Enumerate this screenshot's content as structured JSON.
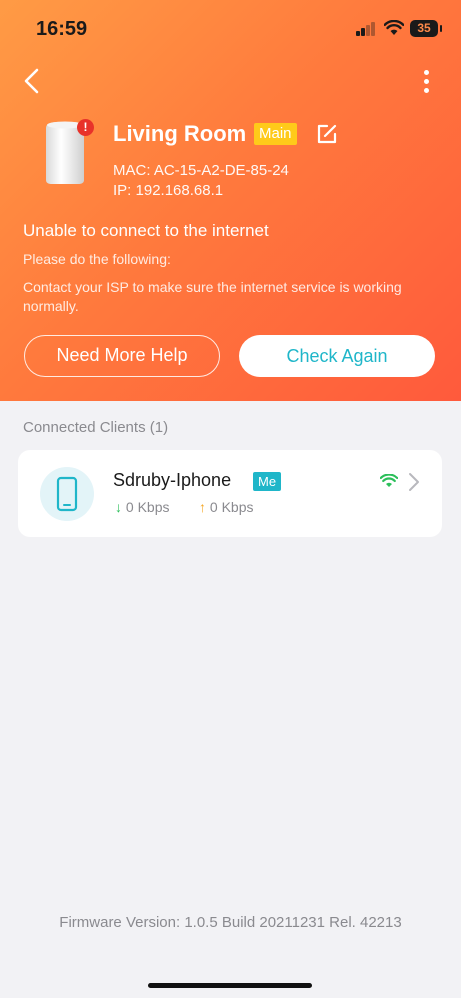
{
  "status_bar": {
    "time": "16:59",
    "battery": "35"
  },
  "device": {
    "name": "Living Room",
    "tag": "Main",
    "mac": "MAC: AC-15-A2-DE-85-24",
    "ip": "IP: 192.168.68.1",
    "alert": "!"
  },
  "error": {
    "title": "Unable to connect to the internet",
    "subtitle": "Please do the following:",
    "description": "Contact your ISP to make sure the internet service is working normally."
  },
  "buttons": {
    "help": "Need More Help",
    "check": "Check Again"
  },
  "clients": {
    "section_title": "Connected Clients (1)",
    "items": [
      {
        "name": "Sdruby-Iphone",
        "tag": "Me",
        "down": "0 Kbps",
        "up": "0 Kbps"
      }
    ]
  },
  "footer": {
    "firmware": "Firmware Version: 1.0.5 Build 20211231 Rel. 42213"
  },
  "colors": {
    "accent": "#1fb6c9",
    "header_start": "#ff9b45",
    "header_end": "#ff5a3c",
    "main_tag": "#ffca1a",
    "alert": "#e8322a"
  }
}
